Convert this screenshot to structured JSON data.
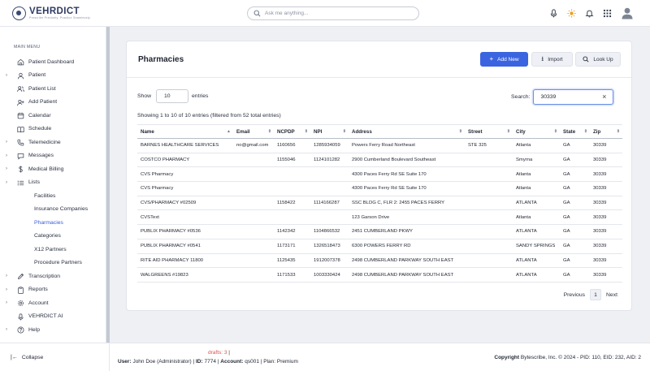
{
  "app": {
    "name": "VEHRDICT",
    "tagline": "Prescribe Precisely. Practice Seamlessly."
  },
  "header": {
    "search_placeholder": "Ask me anything..."
  },
  "icons": {
    "search": "search-icon",
    "mic": "microphone-icon",
    "theme": "sun-icon",
    "notifications": "bell-icon",
    "apps": "grid-icon",
    "user": "user-avatar-icon"
  },
  "colors": {
    "primary": "#3b64e0",
    "active_nav": "#3a5bd9",
    "drafts": "#d9534f",
    "theme_icon": "#f0a21f"
  },
  "sidebar": {
    "section_label": "MAIN MENU",
    "items": [
      {
        "label": "Patient Dashboard",
        "icon": "home-icon",
        "caret": ""
      },
      {
        "label": "Patient",
        "icon": "user-icon",
        "caret": "›"
      },
      {
        "label": "Patient List",
        "icon": "users-icon",
        "caret": ""
      },
      {
        "label": "Add Patient",
        "icon": "add-user-icon",
        "caret": ""
      },
      {
        "label": "Calendar",
        "icon": "calendar-icon",
        "caret": ""
      },
      {
        "label": "Schedule",
        "icon": "book-icon",
        "caret": ""
      },
      {
        "label": "Telemedicine",
        "icon": "phone-icon",
        "caret": "›"
      },
      {
        "label": "Messages",
        "icon": "message-icon",
        "caret": "›"
      },
      {
        "label": "Medical Billing",
        "icon": "dollar-icon",
        "caret": "›"
      },
      {
        "label": "Lists",
        "icon": "list-icon",
        "caret": "›"
      }
    ],
    "sub_items": [
      {
        "label": "Facilities",
        "active": false
      },
      {
        "label": "Insurance Companies",
        "active": false
      },
      {
        "label": "Pharmacies",
        "active": true
      },
      {
        "label": "Categories",
        "active": false
      },
      {
        "label": "X12 Partners",
        "active": false
      },
      {
        "label": "Procedure Partners",
        "active": false
      }
    ],
    "bottom_items": [
      {
        "label": "Transcription",
        "icon": "pen-icon",
        "caret": "›"
      },
      {
        "label": "Reports",
        "icon": "clipboard-icon",
        "caret": "›"
      },
      {
        "label": "Account",
        "icon": "gear-icon",
        "caret": "›"
      },
      {
        "label": "VEHRDICT AI",
        "icon": "microphone-icon",
        "caret": ""
      },
      {
        "label": "Help",
        "icon": "help-icon",
        "caret": "›"
      }
    ],
    "collapse_label": "Collapse"
  },
  "page": {
    "title": "Pharmacies",
    "buttons": {
      "add_new": "Add New",
      "import": "Import",
      "look_up": "Look Up"
    },
    "show_label": "Show",
    "entries_value": "10",
    "entries_label": "entries",
    "search_label": "Search:",
    "search_value": "30339",
    "info": "Showing 1 to 10 of 10 entries (filtered from 52 total entries)",
    "columns": [
      "Name",
      "Email",
      "NCPDP",
      "NPI",
      "Address",
      "Street",
      "City",
      "State",
      "Zip"
    ],
    "rows": [
      [
        "BARNES HEALTHCARE SERVICES",
        "no@gmail.com",
        "1160656",
        "1285934059",
        "Powers Ferry Road Northeast",
        "STE 325",
        "Atlanta",
        "GA",
        "30339"
      ],
      [
        "COSTCO PHARMACY",
        "",
        "1155046",
        "1124101282",
        "2900 Cumberland Boulevard Southeast",
        "",
        "Smyrna",
        "GA",
        "30339"
      ],
      [
        "CVS Pharmacy",
        "",
        "",
        "",
        "4300 Paces Ferry Rd SE Suite 170",
        "",
        "Atlanta",
        "GA",
        "30339"
      ],
      [
        "CVS Pharmacy",
        "",
        "",
        "",
        "4300 Paces Ferry Rd SE Suite 170",
        "",
        "Atlanta",
        "GA",
        "30339"
      ],
      [
        "CVS/PHARMACY #02509",
        "",
        "1158422",
        "1114166287",
        "SSC BLDG C, FLR 2: 2455 PACES FERRY",
        "",
        "ATLANTA",
        "GA",
        "30339"
      ],
      [
        "CVSText",
        "",
        "",
        "",
        "123 Garson Drive",
        "",
        "Atlanta",
        "GA",
        "30339"
      ],
      [
        "PUBLIX PHARMACY #0536",
        "",
        "1142342",
        "1104866532",
        "2451 CUMBERLAND PKWY",
        "",
        "ATLANTA",
        "GA",
        "30339"
      ],
      [
        "PUBLIX PHARMACY #0541",
        "",
        "1173171",
        "1326518473",
        "6300 POWERS FERRY RD",
        "",
        "SANDY SPRINGS",
        "GA",
        "30339"
      ],
      [
        "RITE AID PHARMACY 11800",
        "",
        "1125435",
        "1912007378",
        "2498 CUMBERLAND PARKWAY SOUTH EAST",
        "",
        "ATLANTA",
        "GA",
        "30339"
      ],
      [
        "WALGREENS #19823",
        "",
        "1171533",
        "1003330424",
        "2498 CUMBERLAND PARKWAY SOUTH EAST",
        "",
        "ATLANTA",
        "GA",
        "30339"
      ]
    ],
    "pager": {
      "previous": "Previous",
      "current": "1",
      "next": "Next"
    }
  },
  "footer": {
    "drafts": "drafts: 3",
    "user_label": "User:",
    "user_value": "John Doe (Administrator)",
    "id_label": "ID:",
    "id_value": "7774",
    "account_label": "Account:",
    "account_value": "qs001",
    "plan_text": "Plan: Premium",
    "copyright_label": "Copyright",
    "copyright_text": "Bytescribe, Inc. © 2024 - PID: 110, EID: 232, AID: 2"
  }
}
